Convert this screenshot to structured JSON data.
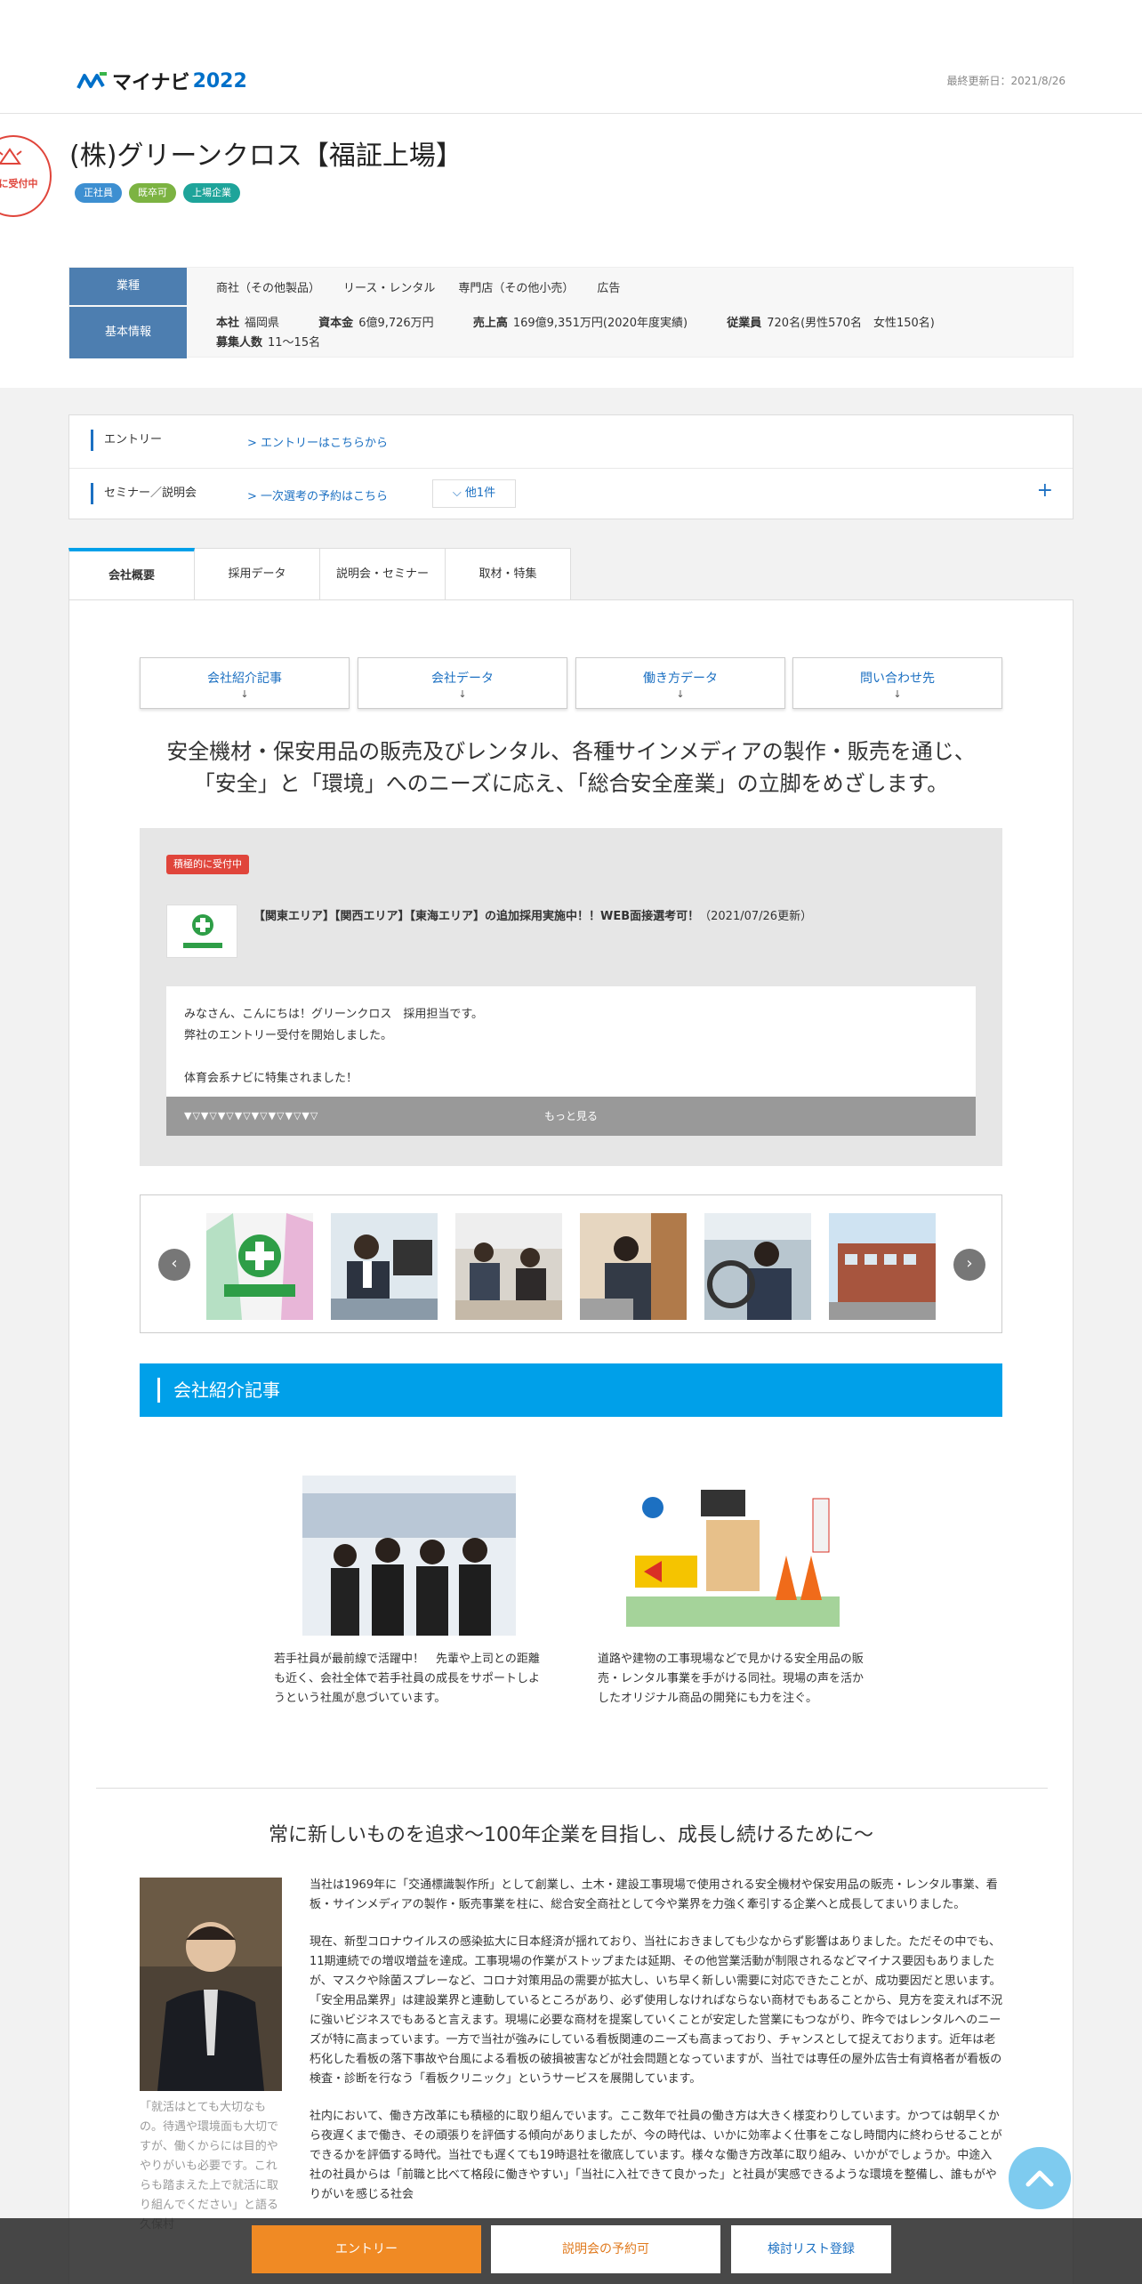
{
  "header": {
    "logo_text": "マイナビ",
    "logo_year": "2022",
    "updated": "最終更新日：2021/8/26"
  },
  "company": {
    "badge": "的に受付中",
    "name": "(株)グリーンクロス【福証上場】",
    "tags": [
      {
        "label": "正社員",
        "color": "#3d8fd1"
      },
      {
        "label": "既卒可",
        "color": "#7cb342"
      },
      {
        "label": "上場企業",
        "color": "#1ea49a"
      }
    ]
  },
  "info": {
    "industry_label": "業種",
    "basic_label": "基本情報",
    "industries": [
      "商社（その他製品）",
      "リース・レンタル",
      "専門店（その他小売）",
      "広告"
    ],
    "basic": [
      {
        "k": "本社",
        "v": "福岡県"
      },
      {
        "k": "資本金",
        "v": "6億9,726万円"
      },
      {
        "k": "売上高",
        "v": "169億9,351万円(2020年度実績)"
      },
      {
        "k": "従業員",
        "v": "720名(男性570名　女性150名)"
      },
      {
        "k": "募集人数",
        "v": "11～15名"
      }
    ]
  },
  "entry": {
    "entry_label": "エントリー",
    "entry_link": "エントリーはこちらから",
    "seminar_label": "セミナー／説明会",
    "seminar_link": "一次選考の予約はこちら",
    "more": "他1件",
    "plus": "+"
  },
  "tabs": [
    "会社概要",
    "採用データ",
    "説明会・セミナー",
    "取材・特集"
  ],
  "anchors": [
    "会社紹介記事",
    "会社データ",
    "働き方データ",
    "問い合わせ先"
  ],
  "catch": {
    "line1": "安全機材・保安用品の販売及びレンタル、各種サインメディアの製作・販売を通じ、",
    "line2": "「安全」と「環境」へのニーズに応え、「総合安全産業」の立脚をめざします。"
  },
  "news": {
    "badge": "積極的に受付中",
    "title": "【関東エリア】【関西エリア】【東海エリア】の追加採用実施中！！WEB面接選考可！",
    "date": "（2021/07/26更新）",
    "body1": "みなさん、こんにちは！グリーンクロス　採用担当です。",
    "body2": "弊社のエントリー受付を開始しました。",
    "body3": "体育会系ナビに特集されました！",
    "pattern": "▼▽▼▽▼▽▼▽▼▽▼▽▼▽▼▽",
    "more": "もっと見る"
  },
  "carousel": {
    "prev": "‹",
    "next": "›"
  },
  "intro": {
    "heading": "会社紹介記事",
    "cap1": "若手社員が最前線で活躍中！　先輩や上司との距離も近く、会社全体で若手社員の成長をサポートしようという社風が息づいています。",
    "cap2": "道路や建物の工事現場などで見かける安全用品の販売・レンタル事業を手がける同社。現場の声を活かしたオリジナル商品の開発にも力を注ぐ。"
  },
  "story": {
    "title": "常に新しいものを追求～100年企業を目指し、成長し続けるために～",
    "ceo_caption": "「就活はとても大切なもの。待遇や環境面も大切ですが、働くからには目的ややりがいも必要です。これらも踏まえた上で就活に取り組んでください」と語る久保村",
    "p1": "当社は1969年に「交通標識製作所」として創業し、土木・建設工事現場で使用される安全機材や保安用品の販売・レンタル事業、看板・サインメディアの製作・販売事業を柱に、総合安全商社として今や業界を力強く牽引する企業へと成長してまいりました。",
    "p2": "現在、新型コロナウイルスの感染拡大に日本経済が揺れており、当社におきましても少なからず影響はありました。ただその中でも、11期連続での増収増益を達成。工事現場の作業がストップまたは延期、その他営業活動が制限されるなどマイナス要因もありましたが、マスクや除菌スプレーなど、コロナ対策用品の需要が拡大し、いち早く新しい需要に対応できたことが、成功要因だと思います。「安全用品業界」は建設業界と連動しているところがあり、必ず使用しなければならない商材でもあることから、見方を変えれば不況に強いビジネスでもあると言えます。現場に必要な商材を提案していくことが安定した営業にもつながり、昨今ではレンタルへのニーズが特に高まっています。一方で当社が強みにしている看板関連のニーズも高まっており、チャンスとして捉えております。近年は老朽化した看板の落下事故や台風による看板の破損被害などが社会問題となっていますが、当社では専任の屋外広告士有資格者が看板の検査・診断を行なう「看板クリニック」というサービスを展開しています。",
    "p3": "社内において、働き方改革にも積極的に取り組んでいます。ここ数年で社員の働き方は大きく様変わりしています。かつては朝早くから夜遅くまで働き、その頑張りを評価する傾向がありましたが、今の時代は、いかに効率よく仕事をこなし時間内に終わらせることができるかを評価する時代。当社でも遅くても19時退社を徹底しています。様々な働き方改革に取り組み、いかがでしょうか。中途入社の社員からは「前職と比べて格段に働きやすい」「当社に入社できて良かった」と社員が実感できるような環境を整備し、誰もがやりがいを感じる社会"
  },
  "bottom": {
    "entry": "エントリー",
    "seminar": "説明会の予約可",
    "list": "検討リスト登録"
  },
  "colors": {
    "accent": "#00a0e9",
    "entry": "#f08a24",
    "link": "#1c70c2"
  }
}
